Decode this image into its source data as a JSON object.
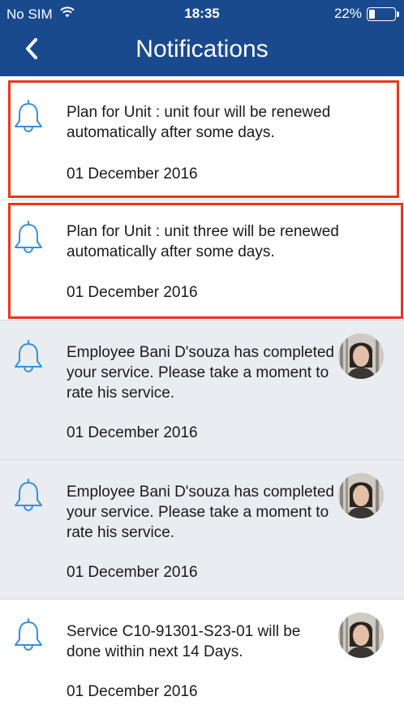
{
  "status_bar": {
    "carrier": "No SIM",
    "time": "18:35",
    "battery": "22%",
    "battery_level": 0.22
  },
  "header": {
    "title": "Notifications",
    "back_icon": "chevron-left-icon"
  },
  "colors": {
    "header_bg": "#1a4a8e",
    "bell": "#3a8fd8",
    "unread_bg": "#e9ecf0",
    "highlight": "#e8361c"
  },
  "notifications": [
    {
      "message": "Plan for Unit : unit four will be renewed automatically after some days.",
      "date": "01 December 2016",
      "icon": "bell-icon"
    },
    {
      "message": "Plan for Unit : unit three will be renewed automatically after some days.",
      "date": "01 December 2016",
      "icon": "bell-icon"
    },
    {
      "message": "Employee Bani D'souza has completed your service. Please take a moment to rate his service.",
      "date": "01 December 2016",
      "icon": "bell-icon"
    },
    {
      "message": "Employee Bani D'souza has completed your service. Please take a moment to rate his service.",
      "date": "01 December 2016",
      "icon": "bell-icon"
    },
    {
      "message": "Service C10-91301-S23-01 will be done within next 14 Days.",
      "date": "01 December 2016",
      "icon": "bell-icon"
    }
  ]
}
